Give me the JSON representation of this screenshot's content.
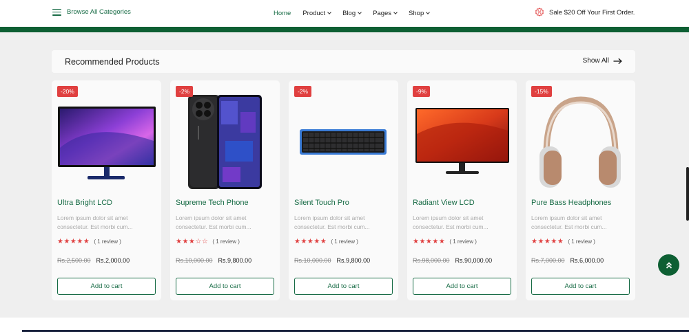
{
  "nav": {
    "browse_label": "Browse All Categories",
    "menu": [
      {
        "label": "Home",
        "active": true,
        "dropdown": false
      },
      {
        "label": "Product",
        "active": false,
        "dropdown": true
      },
      {
        "label": "Blog",
        "active": false,
        "dropdown": true
      },
      {
        "label": "Pages",
        "active": false,
        "dropdown": true
      },
      {
        "label": "Shop",
        "active": false,
        "dropdown": true
      }
    ],
    "promo": "Sale $20 Off Your First Order."
  },
  "section": {
    "title": "Recommended Products",
    "show_all": "Show All"
  },
  "products": [
    {
      "badge": "-20%",
      "name": "Ultra Bright LCD",
      "desc": "Lorem ipsum dolor sit amet consectetur. Est morbi cum...",
      "stars": "★★★★★",
      "reviews": "( 1 review )",
      "old_price": "Rs.2,500.00",
      "price": "Rs.2,000.00",
      "cta": "Add to cart",
      "image": "monitor-purple"
    },
    {
      "badge": "-2%",
      "name": "Supreme Tech Phone",
      "desc": "Lorem ipsum dolor sit amet consectetur. Est morbi cum...",
      "stars": "★★★☆☆",
      "reviews": "( 1 review )",
      "old_price": "Rs.10,000.00",
      "price": "Rs.9,800.00",
      "cta": "Add to cart",
      "image": "phone"
    },
    {
      "badge": "-2%",
      "name": "Silent Touch Pro",
      "desc": "Lorem ipsum dolor sit amet consectetur. Est morbi cum...",
      "stars": "★★★★★",
      "reviews": "( 1 review )",
      "old_price": "Rs.10,000.00",
      "price": "Rs.9,800.00",
      "cta": "Add to cart",
      "image": "keyboard"
    },
    {
      "badge": "-9%",
      "name": "Radiant View LCD",
      "desc": "Lorem ipsum dolor sit amet consectetur. Est morbi cum...",
      "stars": "★★★★★",
      "reviews": "( 1 review )",
      "old_price": "Rs.98,000.00",
      "price": "Rs.90,000.00",
      "cta": "Add to cart",
      "image": "monitor-orange"
    },
    {
      "badge": "-15%",
      "name": "Pure Bass Headphones",
      "desc": "Lorem ipsum dolor sit amet consectetur. Est morbi cum...",
      "stars": "★★★★★",
      "reviews": "( 1 review )",
      "old_price": "Rs.7,000.00",
      "price": "Rs.6,000.00",
      "cta": "Add to cart",
      "image": "headphones"
    }
  ],
  "colors": {
    "brand": "#176b45",
    "brand_dark": "#0d5f33",
    "sale": "#e04040"
  }
}
